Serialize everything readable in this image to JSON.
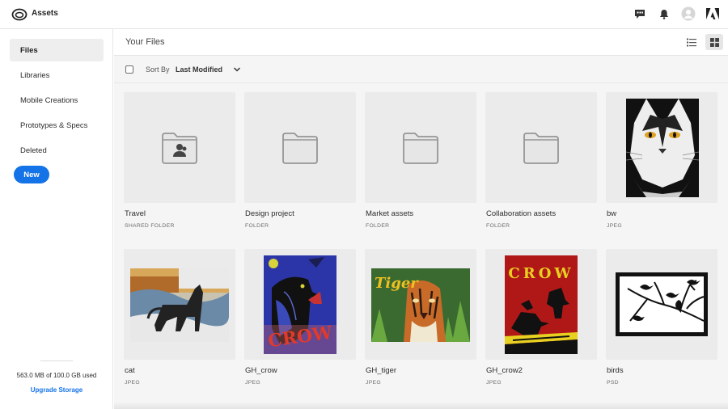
{
  "app": {
    "title": "Assets",
    "logo_icon": "creative-cloud-icon"
  },
  "topbar_icons": [
    "chat-icon",
    "bell-icon",
    "avatar",
    "adobe-logo-icon"
  ],
  "sidebar": {
    "items": [
      {
        "label": "Files",
        "active": true
      },
      {
        "label": "Libraries",
        "active": false
      },
      {
        "label": "Mobile Creations",
        "active": false
      },
      {
        "label": "Prototypes & Specs",
        "active": false
      },
      {
        "label": "Deleted",
        "active": false
      }
    ],
    "new_button": "New",
    "storage_text": "563.0 MB of 100.0 GB used",
    "upgrade_link": "Upgrade Storage"
  },
  "main": {
    "title": "Your Files",
    "sort_label": "Sort By",
    "sort_value": "Last Modified",
    "view_modes": {
      "list": "list-view-icon",
      "grid": "grid-view-icon",
      "selected": "grid"
    }
  },
  "files": [
    {
      "name": "Travel",
      "type": "SHARED FOLDER",
      "thumb": "shared-folder-icon"
    },
    {
      "name": "Design project",
      "type": "FOLDER",
      "thumb": "folder-icon"
    },
    {
      "name": "Market assets",
      "type": "FOLDER",
      "thumb": "folder-icon"
    },
    {
      "name": "Collaboration assets",
      "type": "FOLDER",
      "thumb": "folder-icon"
    },
    {
      "name": "bw",
      "type": "JPEG",
      "thumb": "bw-cat-image"
    },
    {
      "name": "cat",
      "type": "JPEG",
      "thumb": "cat-painting-image"
    },
    {
      "name": "GH_crow",
      "type": "JPEG",
      "thumb": "crow-poster-image",
      "text": "CROW"
    },
    {
      "name": "GH_tiger",
      "type": "JPEG",
      "thumb": "tiger-poster-image",
      "text": "Tiger"
    },
    {
      "name": "GH_crow2",
      "type": "JPEG",
      "thumb": "crow2-poster-image",
      "text": "CROW"
    },
    {
      "name": "birds",
      "type": "PSD",
      "thumb": "birds-silhouette-image"
    }
  ],
  "colors": {
    "accent": "#1473e6",
    "sidebar_active": "#eeeeee",
    "grid_bg": "#f5f5f5"
  }
}
